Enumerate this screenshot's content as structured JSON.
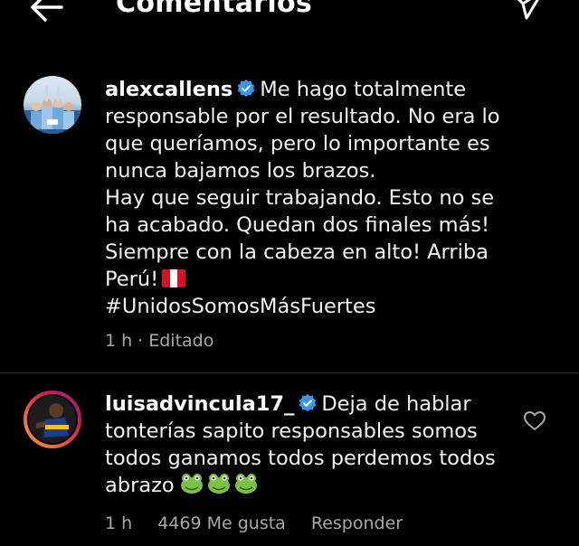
{
  "header": {
    "title": "Comentarios",
    "back_icon": "arrow-left-icon",
    "share_icon": "paper-plane-icon"
  },
  "comments": [
    {
      "username": "alexcallens",
      "verified": true,
      "lines": [
        "Me hago totalmente",
        "responsable por el resultado. No era lo",
        "que queríamos, pero lo importante es",
        "nunca bajamos los brazos.",
        "Hay que seguir trabajando. Esto no se",
        "ha acabado. Quedan dos finales más!",
        "Siempre con la cabeza en alto! Arriba",
        "Perú!",
        "#UnidosSomosMásFuertes"
      ],
      "flag_icon": "peru-flag-icon",
      "time": "1 h",
      "edited_label": "Editado"
    },
    {
      "username": "luisadvincula17_",
      "verified": true,
      "lines": [
        "Deja de hablar",
        "tonterías sapito responsables somos",
        "todos ganamos todos perdemos todos",
        "abrazo"
      ],
      "frog_icons": [
        "frog-emoji-icon",
        "frog-emoji-icon",
        "frog-emoji-icon"
      ],
      "time": "1 h",
      "likes_label": "4469 Me gusta",
      "reply_label": "Responder",
      "like_icon": "heart-outline-icon"
    }
  ],
  "colors": {
    "background": "#000000",
    "text": "#f5f5f5",
    "meta_text": "#a8a8a8",
    "verified_badge": "#3797f0",
    "separator": "#262626"
  }
}
